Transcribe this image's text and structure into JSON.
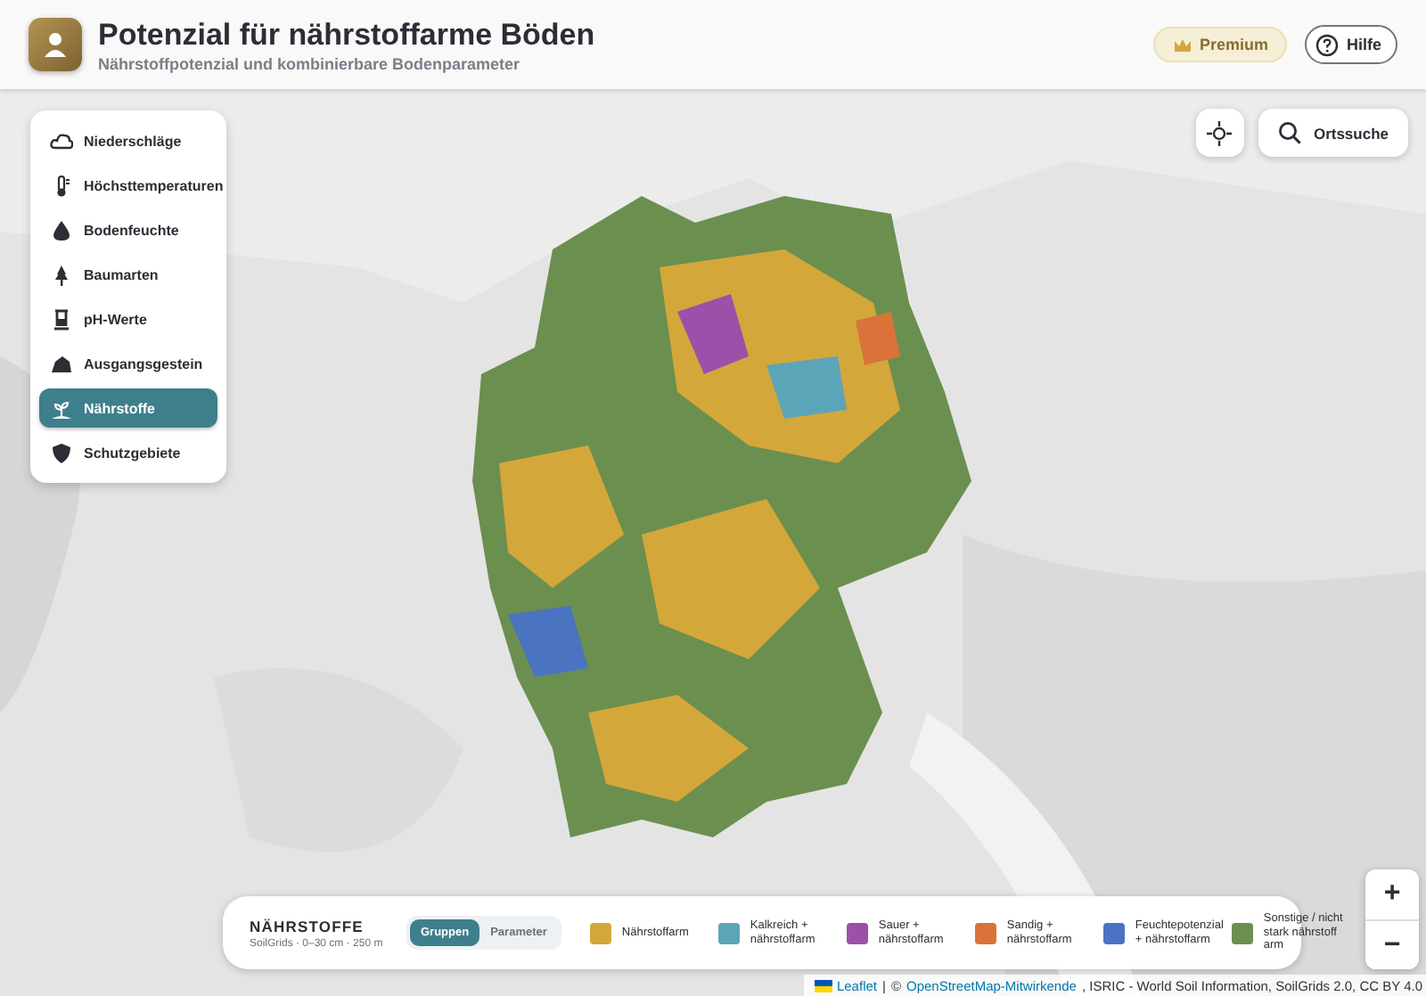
{
  "header": {
    "title": "Potenzial für nährstoffarme Böden",
    "subtitle": "Nährstoffpotenzial und kombinierbare Bodenparameter",
    "premium": "Premium",
    "help": "Hilfe"
  },
  "layers": [
    {
      "label": "Niederschläge",
      "selected": false
    },
    {
      "label": "Höchsttemperaturen",
      "selected": false
    },
    {
      "label": "Bodenfeuchte",
      "selected": false
    },
    {
      "label": "Baumarten",
      "selected": false
    },
    {
      "label": "pH-Werte",
      "selected": false
    },
    {
      "label": "Ausgangsgestein",
      "selected": false
    },
    {
      "label": "Nährstoffe",
      "selected": true
    },
    {
      "label": "Schutzgebiete",
      "selected": false
    }
  ],
  "map_tools": {
    "search": "Ortssuche"
  },
  "legend": {
    "title": "NÄHRSTOFFE",
    "subtitle": "SoilGrids · 0–30 cm · 250 m",
    "toggle": [
      {
        "label": "Gruppen",
        "selected": true
      },
      {
        "label": "Parameter",
        "selected": false
      }
    ],
    "items": [
      {
        "label": "Nährstoffarm",
        "color": "#d4a73a"
      },
      {
        "label": "Kalkreich + nährstoffarm",
        "color": "#5ba5b9"
      },
      {
        "label": "Sauer + nährstoffarm",
        "color": "#9c50a9"
      },
      {
        "label": "Sandig + nährstoffarm",
        "color": "#d9733a"
      },
      {
        "label": "Feuchtepotenzial + nährstoffarm",
        "color": "#4a73c1"
      },
      {
        "label": "Sonstige / nicht stark nährstoff arm",
        "color": "#6b8f4f"
      }
    ]
  },
  "zoom": [
    "+",
    "−"
  ],
  "attribution": [
    {
      "text": "Leaflet",
      "kind": "link"
    },
    {
      "text": "|",
      "kind": "text"
    },
    {
      "text": "©",
      "kind": "text"
    },
    {
      "text": "OpenStreetMap-Mitwirkende",
      "kind": "link"
    },
    {
      "text": ", ISRIC - World Soil Information, SoilGrids 2.0, CC BY 4.0",
      "kind": "text"
    }
  ]
}
